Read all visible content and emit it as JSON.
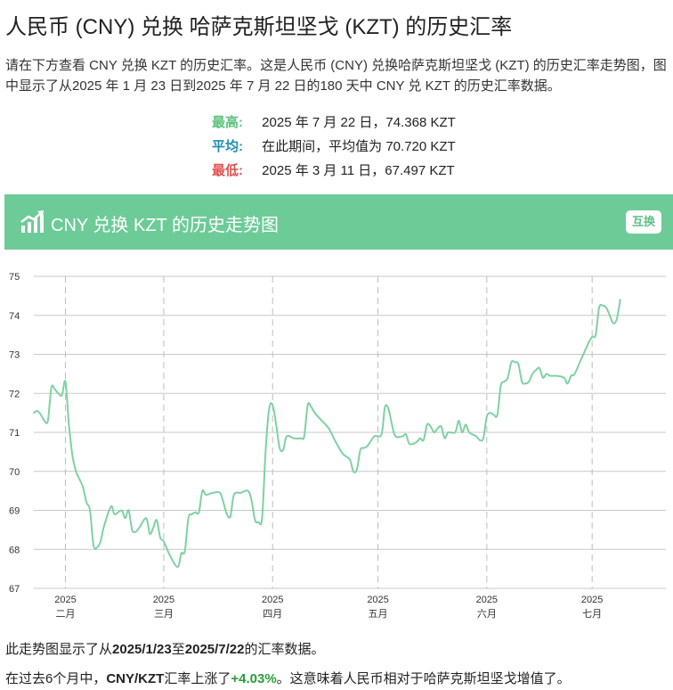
{
  "title": "人民币 (CNY) 兑换 哈萨克斯坦坚戈 (KZT) 的历史汇率",
  "description": "请在下方查看 CNY 兑换 KZT 的历史汇率。这是人民币 (CNY) 兑换哈萨克斯坦坚戈 (KZT) 的历史汇率走势图，图中显示了从2025 年 1 月 23 日到2025 年 7 月 22 日的180 天中 CNY 兑 KZT 的历史汇率数据。",
  "stats": {
    "high_label": "最高:",
    "high_value": "2025 年 7 月 22 日，74.368 KZT",
    "avg_label": "平均:",
    "avg_value": "在此期间，平均值为 70.720 KZT",
    "low_label": "最低:",
    "low_value": "2025 年 3 月 11 日，67.497 KZT"
  },
  "banner": {
    "title": "CNY 兑换 KZT 的历史走势图",
    "icon": "chart-trend-icon",
    "swap_label": "互换"
  },
  "colors": {
    "accent": "#6dcb98",
    "line": "#7fd1a3",
    "high": "#5cc07b",
    "avg": "#1f8fb5",
    "low": "#e05050",
    "increase": "#2a9d3a"
  },
  "chart_data": {
    "type": "line",
    "ylim": [
      67,
      75
    ],
    "yticks": [
      67,
      68,
      69,
      70,
      71,
      72,
      73,
      74,
      75
    ],
    "xlim": [
      "2025-01-23",
      "2025-07-22"
    ],
    "x_ticks": [
      {
        "date": "2025-02-01",
        "year": "2025",
        "month": "二月"
      },
      {
        "date": "2025-03-01",
        "year": "2025",
        "month": "三月"
      },
      {
        "date": "2025-04-01",
        "year": "2025",
        "month": "四月"
      },
      {
        "date": "2025-05-01",
        "year": "2025",
        "month": "五月"
      },
      {
        "date": "2025-06-01",
        "year": "2025",
        "month": "六月"
      },
      {
        "date": "2025-07-01",
        "year": "2025",
        "month": "七月"
      }
    ],
    "grid": true,
    "points": [
      [
        "2025-01-23",
        71.5
      ],
      [
        "2025-01-24",
        71.55
      ],
      [
        "2025-01-25",
        71.45
      ],
      [
        "2025-01-26",
        71.3
      ],
      [
        "2025-01-27",
        71.3
      ],
      [
        "2025-01-28",
        72.15
      ],
      [
        "2025-01-29",
        72.1
      ],
      [
        "2025-01-30",
        72.0
      ],
      [
        "2025-01-31",
        71.95
      ],
      [
        "2025-02-01",
        72.3
      ],
      [
        "2025-02-02",
        71.2
      ],
      [
        "2025-02-03",
        70.4
      ],
      [
        "2025-02-04",
        70.0
      ],
      [
        "2025-02-05",
        69.8
      ],
      [
        "2025-02-06",
        69.6
      ],
      [
        "2025-02-07",
        69.2
      ],
      [
        "2025-02-08",
        69.0
      ],
      [
        "2025-02-09",
        68.1
      ],
      [
        "2025-02-10",
        68.05
      ],
      [
        "2025-02-11",
        68.2
      ],
      [
        "2025-02-12",
        68.6
      ],
      [
        "2025-02-14",
        69.1
      ],
      [
        "2025-02-15",
        68.9
      ],
      [
        "2025-02-17",
        69.0
      ],
      [
        "2025-02-18",
        68.8
      ],
      [
        "2025-02-19",
        69.0
      ],
      [
        "2025-02-20",
        68.5
      ],
      [
        "2025-02-21",
        68.45
      ],
      [
        "2025-02-22",
        68.55
      ],
      [
        "2025-02-24",
        68.8
      ],
      [
        "2025-02-25",
        68.4
      ],
      [
        "2025-02-26",
        68.55
      ],
      [
        "2025-02-27",
        68.75
      ],
      [
        "2025-02-28",
        68.3
      ],
      [
        "2025-03-01",
        68.2
      ],
      [
        "2025-03-03",
        67.8
      ],
      [
        "2025-03-05",
        67.55
      ],
      [
        "2025-03-06",
        67.9
      ],
      [
        "2025-03-07",
        67.95
      ],
      [
        "2025-03-08",
        68.8
      ],
      [
        "2025-03-09",
        68.9
      ],
      [
        "2025-03-10",
        68.95
      ],
      [
        "2025-03-11",
        68.95
      ],
      [
        "2025-03-12",
        69.5
      ],
      [
        "2025-03-13",
        69.4
      ],
      [
        "2025-03-15",
        69.45
      ],
      [
        "2025-03-17",
        69.45
      ],
      [
        "2025-03-18",
        69.2
      ],
      [
        "2025-03-19",
        68.9
      ],
      [
        "2025-03-20",
        68.85
      ],
      [
        "2025-03-21",
        69.4
      ],
      [
        "2025-03-23",
        69.45
      ],
      [
        "2025-03-25",
        69.5
      ],
      [
        "2025-03-26",
        69.25
      ],
      [
        "2025-03-27",
        68.75
      ],
      [
        "2025-03-28",
        68.7
      ],
      [
        "2025-03-29",
        68.8
      ],
      [
        "2025-03-30",
        70.5
      ],
      [
        "2025-03-31",
        71.6
      ],
      [
        "2025-04-01",
        71.7
      ],
      [
        "2025-04-02",
        71.2
      ],
      [
        "2025-04-03",
        70.6
      ],
      [
        "2025-04-04",
        70.55
      ],
      [
        "2025-04-05",
        70.9
      ],
      [
        "2025-04-07",
        70.85
      ],
      [
        "2025-04-09",
        70.85
      ],
      [
        "2025-04-10",
        70.9
      ],
      [
        "2025-04-11",
        71.7
      ],
      [
        "2025-04-12",
        71.65
      ],
      [
        "2025-04-13",
        71.5
      ],
      [
        "2025-04-15",
        71.3
      ],
      [
        "2025-04-17",
        71.1
      ],
      [
        "2025-04-19",
        70.75
      ],
      [
        "2025-04-21",
        70.45
      ],
      [
        "2025-04-23",
        70.3
      ],
      [
        "2025-04-24",
        70.0
      ],
      [
        "2025-04-25",
        70.05
      ],
      [
        "2025-04-26",
        70.55
      ],
      [
        "2025-04-27",
        70.6
      ],
      [
        "2025-04-28",
        70.65
      ],
      [
        "2025-04-30",
        70.9
      ],
      [
        "2025-05-02",
        70.95
      ],
      [
        "2025-05-03",
        71.65
      ],
      [
        "2025-05-04",
        71.6
      ],
      [
        "2025-05-05",
        71.2
      ],
      [
        "2025-05-06",
        70.9
      ],
      [
        "2025-05-08",
        70.9
      ],
      [
        "2025-05-09",
        70.95
      ],
      [
        "2025-05-10",
        70.7
      ],
      [
        "2025-05-12",
        70.75
      ],
      [
        "2025-05-13",
        70.85
      ],
      [
        "2025-05-14",
        70.8
      ],
      [
        "2025-05-15",
        71.2
      ],
      [
        "2025-05-16",
        71.15
      ],
      [
        "2025-05-17",
        71.0
      ],
      [
        "2025-05-18",
        71.1
      ],
      [
        "2025-05-19",
        71.15
      ],
      [
        "2025-05-20",
        70.85
      ],
      [
        "2025-05-21",
        71.0
      ],
      [
        "2025-05-23",
        71.0
      ],
      [
        "2025-05-24",
        71.3
      ],
      [
        "2025-05-25",
        71.0
      ],
      [
        "2025-05-26",
        71.2
      ],
      [
        "2025-05-27",
        71.0
      ],
      [
        "2025-05-29",
        70.9
      ],
      [
        "2025-05-30",
        70.8
      ],
      [
        "2025-05-31",
        70.85
      ],
      [
        "2025-06-01",
        71.4
      ],
      [
        "2025-06-02",
        71.5
      ],
      [
        "2025-06-03",
        71.45
      ],
      [
        "2025-06-04",
        71.45
      ],
      [
        "2025-06-05",
        72.2
      ],
      [
        "2025-06-06",
        72.3
      ],
      [
        "2025-06-07",
        72.4
      ],
      [
        "2025-06-08",
        72.8
      ],
      [
        "2025-06-09",
        72.8
      ],
      [
        "2025-06-10",
        72.75
      ],
      [
        "2025-06-11",
        72.3
      ],
      [
        "2025-06-12",
        72.25
      ],
      [
        "2025-06-13",
        72.3
      ],
      [
        "2025-06-14",
        72.5
      ],
      [
        "2025-06-15",
        72.6
      ],
      [
        "2025-06-16",
        72.65
      ],
      [
        "2025-06-17",
        72.4
      ],
      [
        "2025-06-18",
        72.5
      ],
      [
        "2025-06-19",
        72.45
      ],
      [
        "2025-06-21",
        72.45
      ],
      [
        "2025-06-23",
        72.4
      ],
      [
        "2025-06-24",
        72.25
      ],
      [
        "2025-06-25",
        72.45
      ],
      [
        "2025-06-26",
        72.5
      ],
      [
        "2025-06-28",
        72.9
      ],
      [
        "2025-06-30",
        73.3
      ],
      [
        "2025-07-01",
        73.45
      ],
      [
        "2025-07-02",
        73.5
      ],
      [
        "2025-07-03",
        74.2
      ],
      [
        "2025-07-04",
        74.25
      ],
      [
        "2025-07-05",
        74.2
      ],
      [
        "2025-07-06",
        74.0
      ],
      [
        "2025-07-07",
        73.8
      ],
      [
        "2025-07-08",
        73.9
      ],
      [
        "2025-07-09",
        74.4
      ]
    ]
  },
  "footer": {
    "line1_prefix": "此走势图显示了从",
    "line1_start": "2025/1/23",
    "line1_mid": "至",
    "line1_end": "2025/7/22",
    "line1_suffix": "的汇率数据。",
    "line2_prefix": "在过去6个月中，",
    "line2_pair": "CNY/KZT",
    "line2_mid": "汇率上涨了",
    "line2_pct": "+4.03%",
    "line2_suffix": "。这意味着人民币相对于哈萨克斯坦坚戈增值了。"
  }
}
